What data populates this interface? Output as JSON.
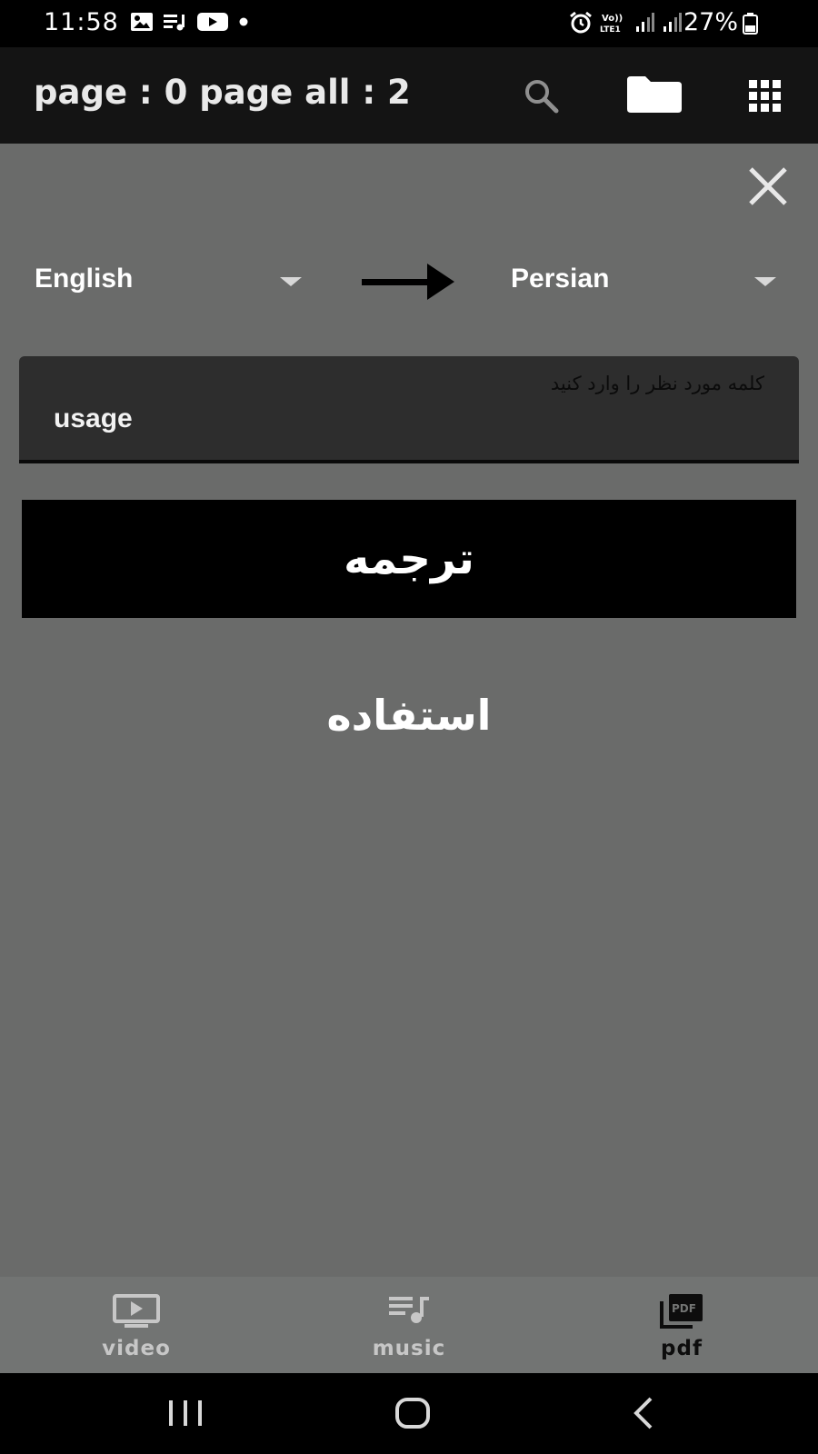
{
  "status_bar": {
    "time": "11:58",
    "battery": "27%"
  },
  "app_bar": {
    "title": "page : 0 page all : 2",
    "icons": [
      "search-icon",
      "folder-icon",
      "grid-icon"
    ]
  },
  "translator": {
    "source_language": "English",
    "target_language": "Persian",
    "input_hint": "کلمه مورد نظر را وارد کنید",
    "input_value": "usage",
    "translate_button": "ترجمه",
    "result": "استفاده"
  },
  "bottom_nav": {
    "items": [
      {
        "label": "video",
        "icon": "video-icon"
      },
      {
        "label": "music",
        "icon": "music-icon"
      },
      {
        "label": "pdf",
        "icon": "pdf-icon"
      }
    ],
    "active": "pdf"
  },
  "colors": {
    "background": "#6a6b6a",
    "app_bar": "#141414",
    "input_bg": "#2d2d2d",
    "button_bg": "#000000",
    "bottom_nav": "#727473"
  }
}
